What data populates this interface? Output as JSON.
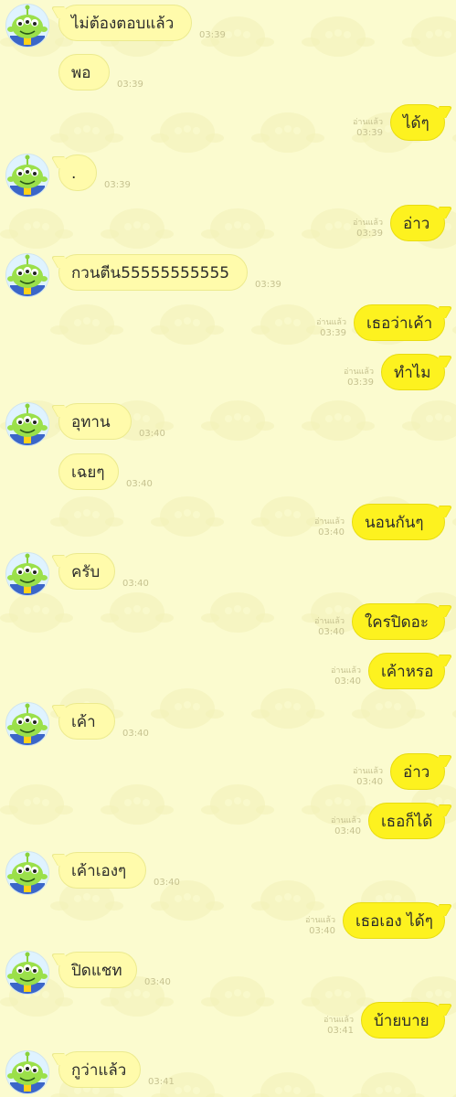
{
  "messages": [
    {
      "dir": "in",
      "first": true,
      "text": "ไม่ต้องตอบแล้ว",
      "time": "03:39"
    },
    {
      "dir": "in",
      "first": false,
      "text": "พอ",
      "time": "03:39"
    },
    {
      "dir": "out",
      "text": "ได้ๆ",
      "time": "03:39",
      "read": "อ่านแล้ว"
    },
    {
      "dir": "in",
      "first": true,
      "text": ".",
      "time": "03:39"
    },
    {
      "dir": "out",
      "text": "อ่าว",
      "time": "03:39",
      "read": "อ่านแล้ว"
    },
    {
      "dir": "in",
      "first": true,
      "text": "กวนตีน55555555555",
      "time": "03:39"
    },
    {
      "dir": "out",
      "text": "เธอว่าเค้า",
      "time": "03:39",
      "read": "อ่านแล้ว"
    },
    {
      "dir": "out",
      "text": "ทำไม",
      "time": "03:39",
      "read": "อ่านแล้ว"
    },
    {
      "dir": "in",
      "first": true,
      "text": "อุทาน",
      "time": "03:40"
    },
    {
      "dir": "in",
      "first": false,
      "text": "เฉยๆ",
      "time": "03:40"
    },
    {
      "dir": "out",
      "text": "นอนกันๆ",
      "time": "03:40",
      "read": "อ่านแล้ว"
    },
    {
      "dir": "in",
      "first": true,
      "text": "ครับ",
      "time": "03:40"
    },
    {
      "dir": "out",
      "text": "ใครปิดอะ",
      "time": "03:40",
      "read": "อ่านแล้ว"
    },
    {
      "dir": "out",
      "text": "เค้าหรอ",
      "time": "03:40",
      "read": "อ่านแล้ว"
    },
    {
      "dir": "in",
      "first": true,
      "text": "เค้า",
      "time": "03:40"
    },
    {
      "dir": "out",
      "text": "อ่าว",
      "time": "03:40",
      "read": "อ่านแล้ว"
    },
    {
      "dir": "out",
      "text": "เธอก็ได้",
      "time": "03:40",
      "read": "อ่านแล้ว"
    },
    {
      "dir": "in",
      "first": true,
      "text": "เค้าเองๆ",
      "time": "03:40"
    },
    {
      "dir": "out",
      "text": "เธอเอง ได้ๆ",
      "time": "03:40",
      "read": "อ่านแล้ว"
    },
    {
      "dir": "in",
      "first": true,
      "text": "ปิดแชท",
      "time": "03:40"
    },
    {
      "dir": "out",
      "text": "บ้ายบาย",
      "time": "03:41",
      "read": "อ่านแล้ว"
    },
    {
      "dir": "in",
      "first": true,
      "text": "กูว่าแล้ว",
      "time": "03:41"
    }
  ],
  "colors": {
    "background": "#fbfbcf",
    "incoming_bubble": "#fffbab",
    "outgoing_bubble": "#fdf21f",
    "meta_text": "#c6c290"
  },
  "icons": {
    "avatar": "alien-avatar-icon"
  }
}
